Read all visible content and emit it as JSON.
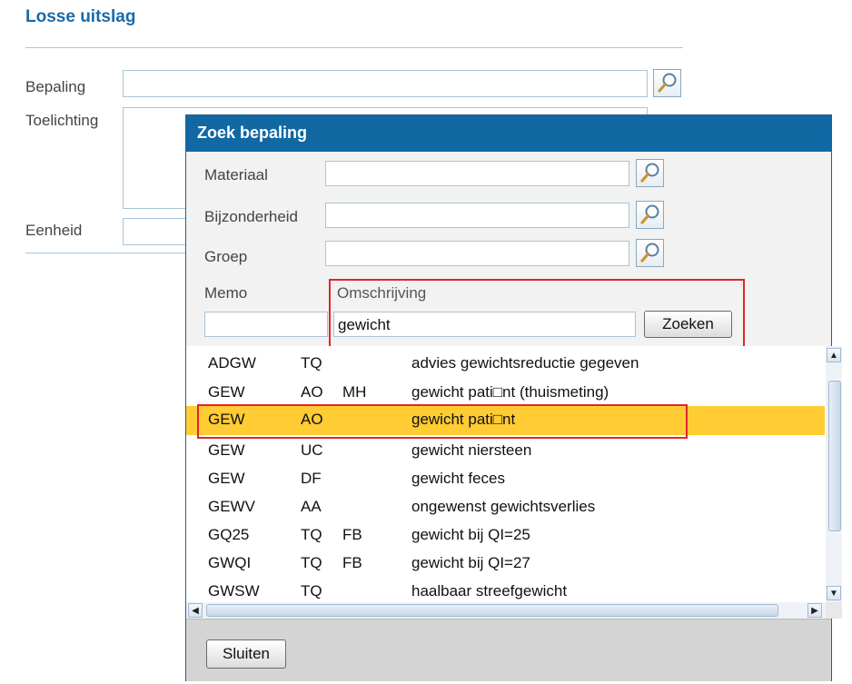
{
  "page": {
    "section_title": "Losse uitslag",
    "fields": {
      "bepaling_label": "Bepaling",
      "bepaling_value": "",
      "toelichting_label": "Toelichting",
      "toelichting_value": "",
      "eenheid_label": "Eenheid",
      "eenheid_value": ""
    }
  },
  "dialog": {
    "title": "Zoek bepaling",
    "materiaal_label": "Materiaal",
    "materiaal_value": "",
    "bijzonderheid_label": "Bijzonderheid",
    "bijzonderheid_value": "",
    "groep_label": "Groep",
    "groep_value": "",
    "memo_label": "Memo",
    "memo_value": "",
    "omschrijving_label": "Omschrijving",
    "omschrijving_value": "gewicht",
    "search_button": "Zoeken",
    "close_button": "Sluiten",
    "results": [
      {
        "code": "ADGW",
        "mat": "TQ",
        "extra": "",
        "desc": "advies gewichtsreductie gegeven"
      },
      {
        "code": "GEW",
        "mat": "AO",
        "extra": "MH",
        "desc": "gewicht pati□nt (thuismeting)"
      },
      {
        "code": "GEW",
        "mat": "AO",
        "extra": "",
        "desc": "gewicht pati□nt",
        "selected": true
      },
      {
        "code": "GEW",
        "mat": "UC",
        "extra": "",
        "desc": "gewicht niersteen"
      },
      {
        "code": "GEW",
        "mat": "DF",
        "extra": "",
        "desc": "gewicht feces"
      },
      {
        "code": "GEWV",
        "mat": "AA",
        "extra": "",
        "desc": "ongewenst gewichtsverlies"
      },
      {
        "code": "GQ25",
        "mat": "TQ",
        "extra": "FB",
        "desc": "gewicht bij QI=25"
      },
      {
        "code": "GWQI",
        "mat": "TQ",
        "extra": "FB",
        "desc": "gewicht bij QI=27"
      },
      {
        "code": "GWSW",
        "mat": "TQ",
        "extra": "",
        "desc": "haalbaar streefgewicht"
      }
    ]
  },
  "icons": {
    "lookup": "magnifier-icon",
    "scroll_up": "arrow-up-icon",
    "scroll_down": "arrow-down-icon",
    "scroll_left": "arrow-left-icon",
    "scroll_right": "arrow-right-icon"
  },
  "colors": {
    "header_blue": "#1168a3",
    "selection": "#ffcc33",
    "highlight_border": "#e0262b"
  }
}
